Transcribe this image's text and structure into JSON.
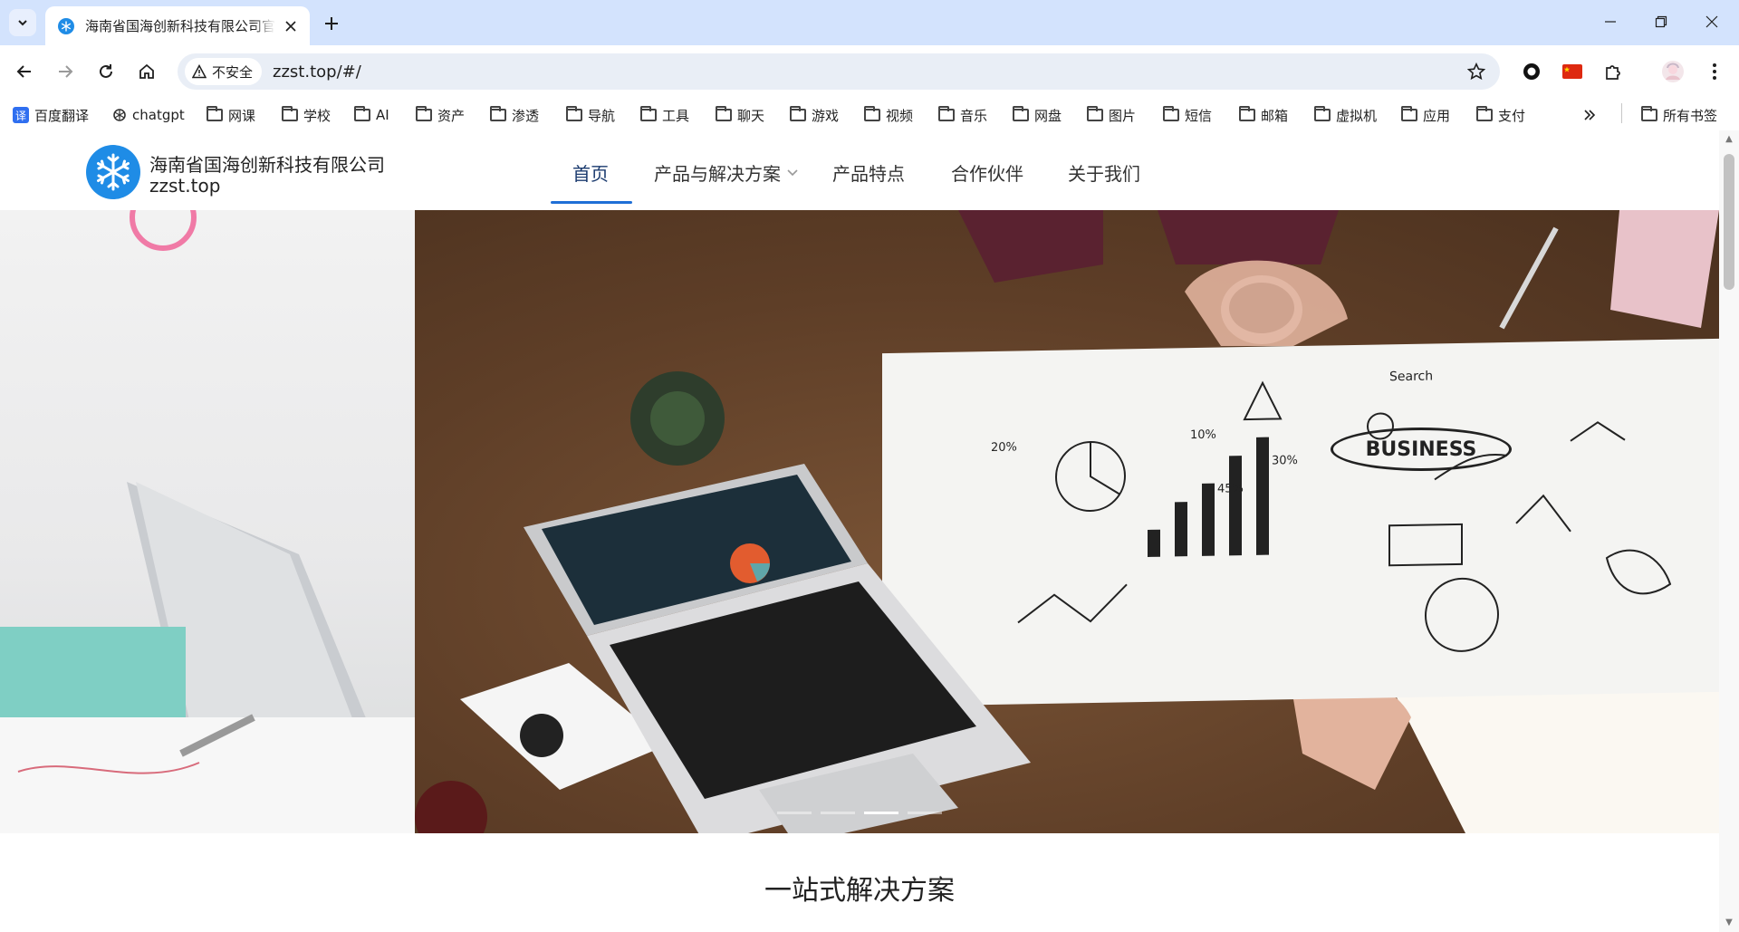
{
  "browser": {
    "tab_title": "海南省国海创新科技有限公司官",
    "security_label": "不安全",
    "url": "zzst.top/#/"
  },
  "bookmarks": [
    {
      "label": "百度翻译",
      "icon": "translate-icon"
    },
    {
      "label": "chatgpt",
      "icon": "openai-icon"
    },
    {
      "label": "网课",
      "icon": "folder-icon"
    },
    {
      "label": "学校",
      "icon": "folder-icon"
    },
    {
      "label": "AI",
      "icon": "folder-icon"
    },
    {
      "label": "资产",
      "icon": "folder-icon"
    },
    {
      "label": "渗透",
      "icon": "folder-icon"
    },
    {
      "label": "导航",
      "icon": "folder-icon"
    },
    {
      "label": "工具",
      "icon": "folder-icon"
    },
    {
      "label": "聊天",
      "icon": "folder-icon"
    },
    {
      "label": "游戏",
      "icon": "folder-icon"
    },
    {
      "label": "视频",
      "icon": "folder-icon"
    },
    {
      "label": "音乐",
      "icon": "folder-icon"
    },
    {
      "label": "网盘",
      "icon": "folder-icon"
    },
    {
      "label": "图片",
      "icon": "folder-icon"
    },
    {
      "label": "短信",
      "icon": "folder-icon"
    },
    {
      "label": "邮箱",
      "icon": "folder-icon"
    },
    {
      "label": "虚拟机",
      "icon": "folder-icon"
    },
    {
      "label": "应用",
      "icon": "folder-icon"
    },
    {
      "label": "支付",
      "icon": "folder-icon"
    }
  ],
  "all_bookmarks_label": "所有书签",
  "site": {
    "brand_name": "海南省国海创新科技有限公司",
    "brand_domain": "zzst.top",
    "menu": [
      "首页",
      "产品与解决方案",
      "产品特点",
      "合作伙伴",
      "关于我们"
    ],
    "active_menu": "首页",
    "hero_text": "BUSINESS",
    "carousel_slides": 4,
    "carousel_active_index": 2,
    "section_title": "一站式解决方案"
  },
  "colors": {
    "tabstrip": "#d3e3fd",
    "brand_blue": "#1f8ce6",
    "active_underline": "#1f6fd6"
  }
}
